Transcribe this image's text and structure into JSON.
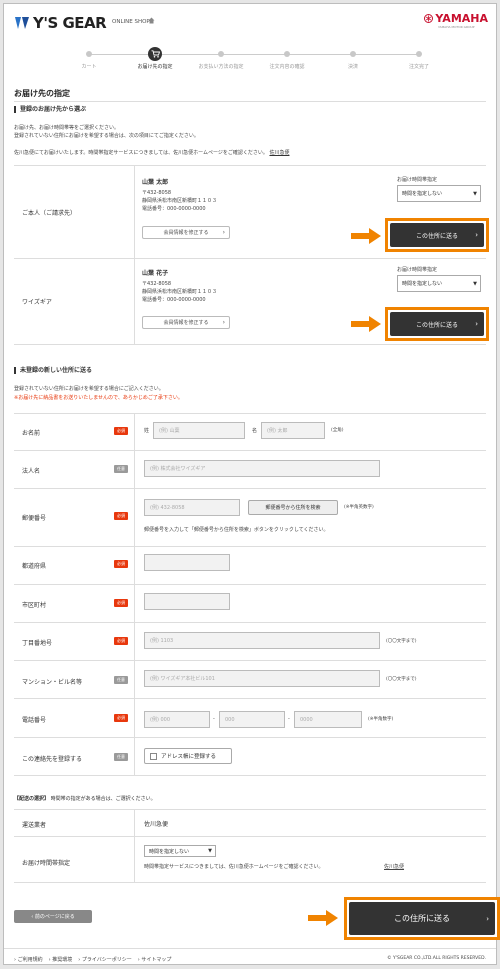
{
  "header": {
    "brand": "Y'S GEAR",
    "shop_label": "ONLINE SHOP",
    "maker": "YAMAHA",
    "maker_sub": "YAMAHA MOTOR GROUP"
  },
  "steps": [
    "カート",
    "お届け先の指定",
    "お支払い方法の指定",
    "注文内容の確認",
    "決済",
    "注文完了"
  ],
  "page_title": "お届け先の指定",
  "registered": {
    "heading": "登録のお届け先から選ぶ",
    "intro_1": "お届け先、お届け時間帯等をご選択ください。",
    "intro_2": "登録されていない住所にお届けを希望する場合は、次の項目にてご指定ください。",
    "intro_3": "佐川急便にてお届けいたします。時間帯指定サービスにつきましては、佐川急便ホームページをご確認ください。",
    "link": "佐川急便",
    "delivery_time_label": "お届け時間帯指定",
    "delivery_time_value": "時間を指定しない",
    "edit_label": "会員情報を修正する",
    "send_label": "この住所に送る",
    "addresses": [
      {
        "label": "ご本人（ご請求先）",
        "name": "山葉 太郎",
        "zip": "〒432-8058",
        "address": "静岡県浜松市南区新橋町１１０３",
        "phone": "電話番号：000-0000-0000"
      },
      {
        "label": "ワイズギア",
        "name": "山葉 花子",
        "zip": "〒432-8058",
        "address": "静岡県浜松市南区新橋町１１０３",
        "phone": "電話番号：000-0000-0000"
      }
    ]
  },
  "new_address": {
    "heading": "未登録の新しい住所に送る",
    "intro": "登録されていない住所にお届けを希望する場合にご記入ください。",
    "warning": "※お届け先に納品書をお送りいたしませんので、あらかじめご了承下さい。",
    "required_tag": "必須",
    "optional_tag": "任意",
    "fields": {
      "name": {
        "label": "お名前",
        "last_prefix": "姓",
        "last_placeholder": "(例) 山葉",
        "first_prefix": "名",
        "first_placeholder": "(例) 太郎",
        "note": "(全角)"
      },
      "company": {
        "label": "法人名",
        "placeholder": "(例) 株式会社ワイズギア"
      },
      "zip": {
        "label": "郵便番号",
        "placeholder": "(例) 432-8058",
        "button": "郵便番号から住所を検索",
        "note": "(※半角英数字)",
        "help": "郵便番号を入力して「郵便番号から住所を検索」ボタンをクリックしてください。"
      },
      "prefecture": {
        "label": "都道府県"
      },
      "city": {
        "label": "市区町村"
      },
      "street": {
        "label": "丁目番地号",
        "placeholder": "(例) 1103",
        "note": "(〇〇文字まで)"
      },
      "building": {
        "label": "マンション・ビル名等",
        "placeholder": "(例) ワイズギア本社ビル101",
        "note": "(〇〇文字まで)"
      },
      "phone": {
        "label": "電話番号",
        "p1": "(例) 000",
        "p2": "000",
        "p3": "0000",
        "sep": "-",
        "note": "(※半角数字)"
      },
      "save": {
        "label": "この連絡先を登録する",
        "checkbox": "アドレス帳に登録する"
      }
    }
  },
  "shipping": {
    "heading": "【配送の選択】",
    "heading_note": "時間帯の指定がある場合は、ご選択ください。",
    "carrier_label": "運送業者",
    "carrier_value": "佐川急便",
    "time_label": "お届け時間帯指定",
    "time_value": "時間を指定しない",
    "time_note": "時間帯指定サービスにつきましては、佐川急便ホームページをご確認ください。",
    "link": "佐川急便"
  },
  "back_label": "前のページに戻る",
  "send_big_label": "この住所に送る",
  "footer": {
    "links": [
      "ご利用規約",
      "推奨環境",
      "プライバシーポリシー",
      "サイトマップ"
    ],
    "copyright": "© Y'SGEAR CO.,LTD.ALL RIGHTS RESERVED."
  },
  "colors": {
    "accent": "#f08300",
    "required": "#e8380d",
    "button": "#333333",
    "brand_red": "#c8102e"
  }
}
